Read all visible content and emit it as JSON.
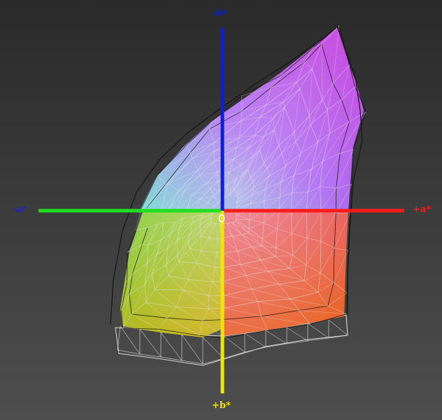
{
  "axes": {
    "neg_b": {
      "label": "-b*",
      "color": "#0b1fd6"
    },
    "pos_b": {
      "label": "+b*",
      "color": "#f2e600"
    },
    "neg_a": {
      "label": "-a*",
      "color": "#2222cc"
    },
    "pos_a": {
      "label": "+a*",
      "color": "#ff1a1a"
    },
    "green_axis_color": "#1ee01e",
    "origin_marker_color": "#ffffff"
  },
  "gamut": {
    "colors": {
      "top": "#a65ff0",
      "cyan": "#6fd8d0",
      "green": "#7fd03a",
      "yellow": "#c8b41e",
      "orange": "#e8642a",
      "red": "#e8506a",
      "magenta": "#d050e0",
      "mesh_outer": "#111111",
      "mesh_inner": "#e8e8e8"
    }
  }
}
